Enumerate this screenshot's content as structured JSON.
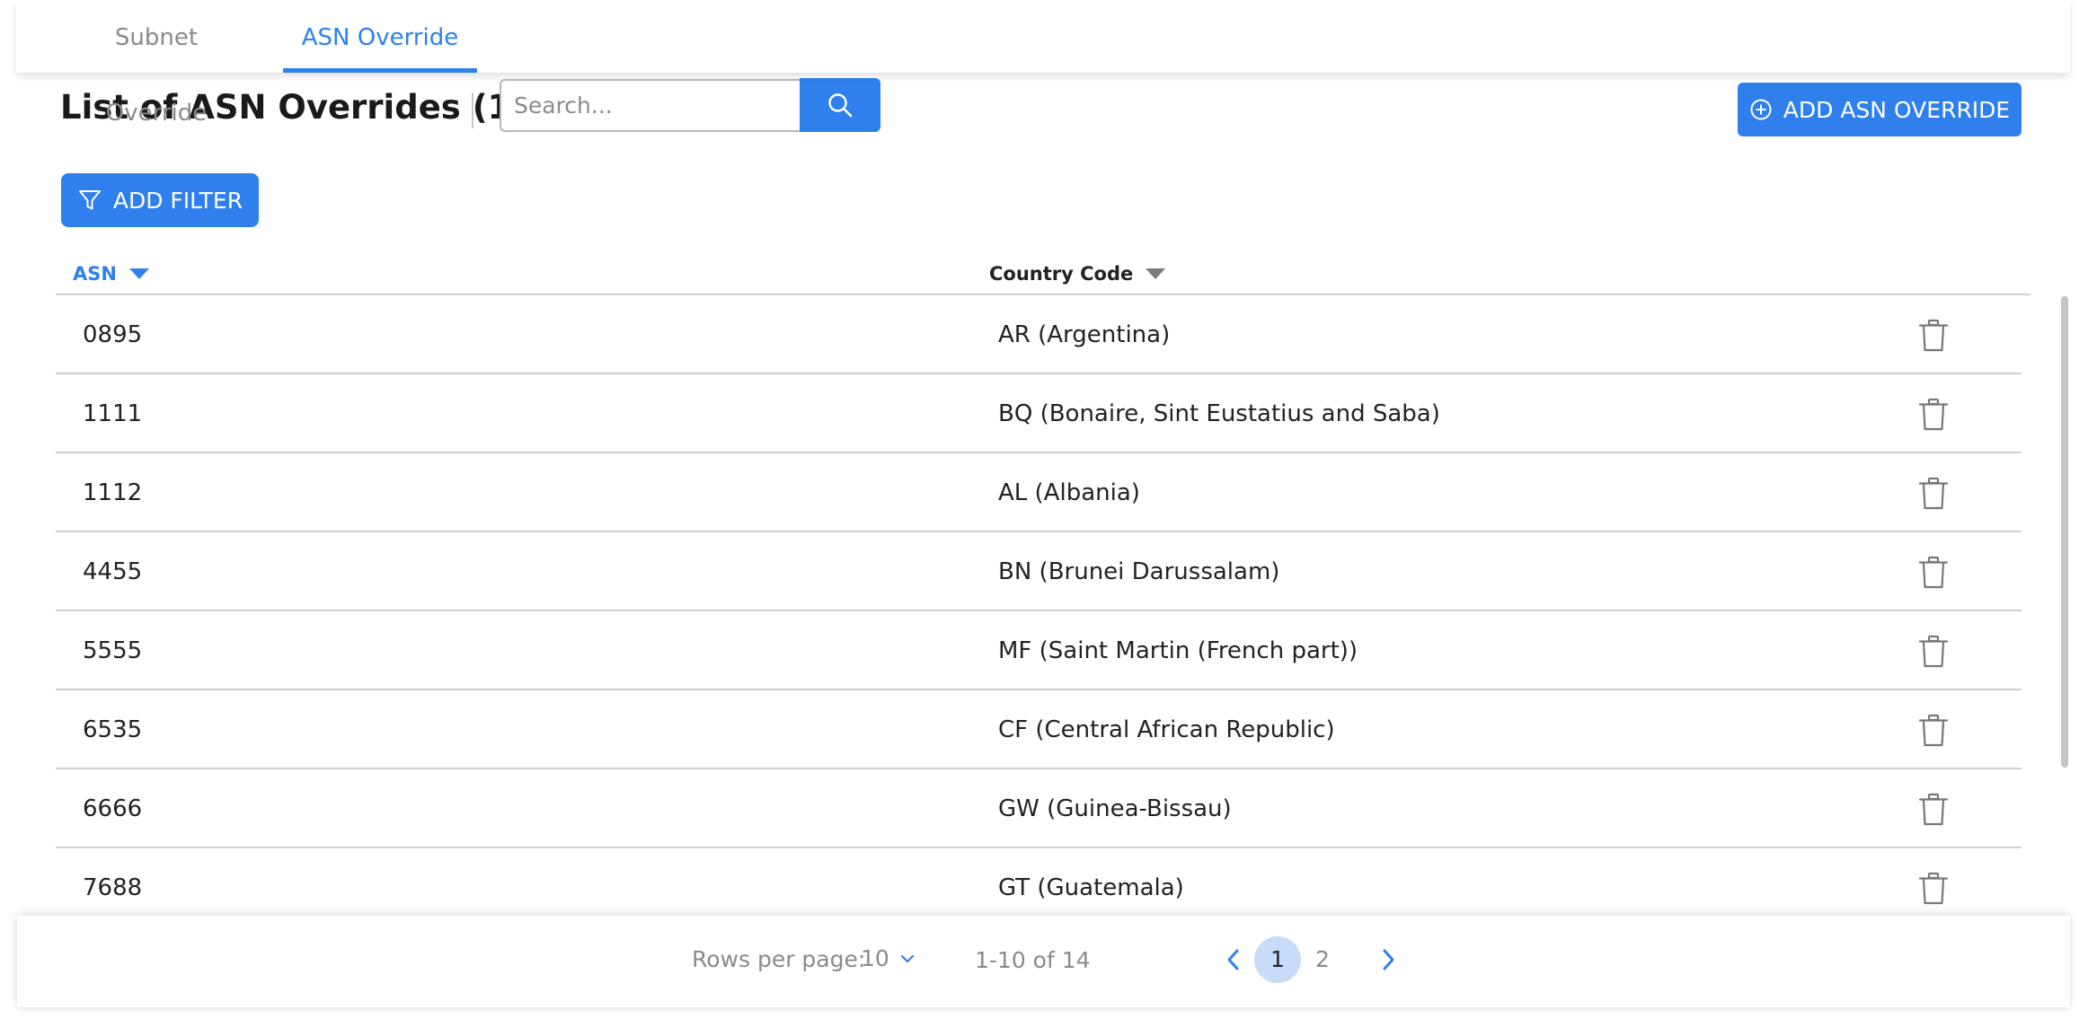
{
  "tabs": [
    {
      "label": "Subnet Override",
      "active": false
    },
    {
      "label": "ASN Override",
      "active": true
    }
  ],
  "page_title": "List of ASN Overrides (14)",
  "search": {
    "placeholder": "Search...",
    "value": ""
  },
  "buttons": {
    "add_asn_override": "ADD ASN OVERRIDE",
    "add_filter": "ADD FILTER"
  },
  "table": {
    "columns": [
      {
        "label": "ASN",
        "sorted": true
      },
      {
        "label": "Country Code",
        "sorted": false
      }
    ],
    "rows": [
      {
        "asn": "0895",
        "country": "AR (Argentina)"
      },
      {
        "asn": "1111",
        "country": "BQ (Bonaire, Sint Eustatius and Saba)"
      },
      {
        "asn": "1112",
        "country": "AL (Albania)"
      },
      {
        "asn": "4455",
        "country": "BN (Brunei Darussalam)"
      },
      {
        "asn": "5555",
        "country": "MF (Saint Martin (French part))"
      },
      {
        "asn": "6535",
        "country": "CF (Central African Republic)"
      },
      {
        "asn": "6666",
        "country": "GW (Guinea-Bissau)"
      },
      {
        "asn": "7688",
        "country": "GT (Guatemala)"
      }
    ]
  },
  "pagination": {
    "rows_per_page_label": "Rows per page:",
    "rows_per_page_value": "10",
    "range_text": "1-10 of 14",
    "pages": [
      "1",
      "2"
    ],
    "current_page": "1"
  },
  "icons": {
    "search": "search-icon",
    "add": "plus-circle-icon",
    "filter": "filter-icon",
    "delete": "trash-icon",
    "prev": "chevron-left-icon",
    "next": "chevron-right-icon",
    "dropdown": "chevron-down-icon"
  },
  "colors": {
    "accent": "#2f80ed",
    "active_page_bg": "#c6dcf8",
    "muted_text": "#8a8a8a",
    "divider": "#cfcfcf"
  }
}
